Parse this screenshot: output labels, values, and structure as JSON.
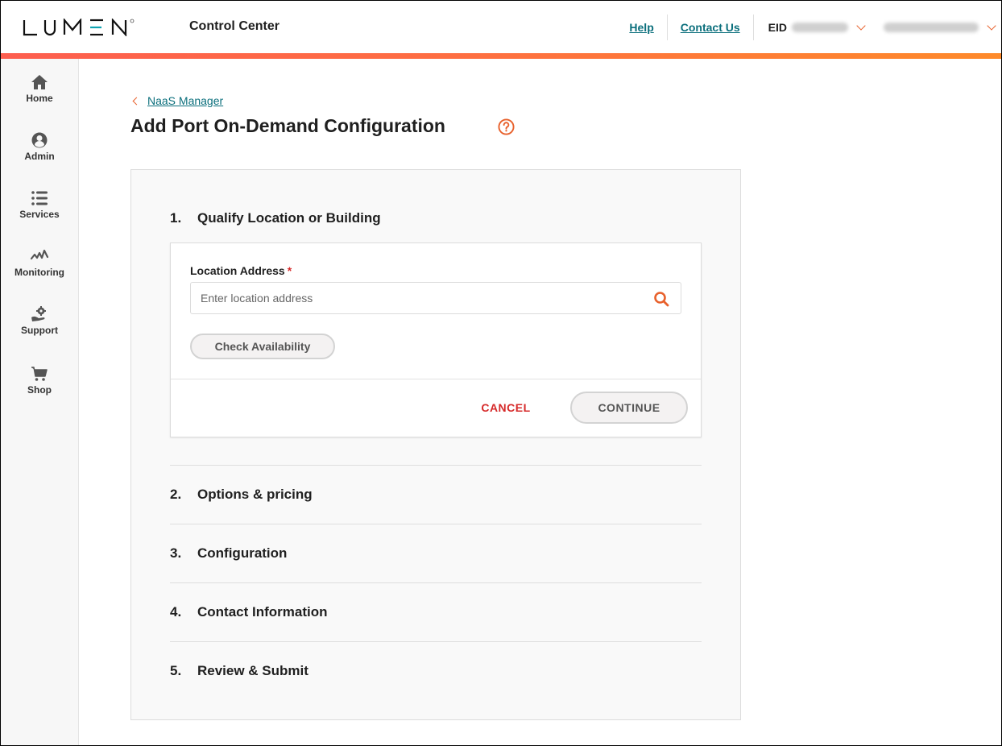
{
  "header": {
    "logo_text": "LUMEN",
    "app_title": "Control Center",
    "links": [
      "Help",
      "Contact Us"
    ],
    "eid_label": "EID",
    "eid_value_redacted": true,
    "user_value_redacted": true
  },
  "colors": {
    "brand_orange": "#e8612c",
    "link_teal": "#0b6f7c",
    "cancel_red": "#d62a2a",
    "gradient_start": "#fd5e4f",
    "gradient_end": "#fe8a2a"
  },
  "sidebar": {
    "items": [
      {
        "label": "Home",
        "icon": "home-icon"
      },
      {
        "label": "Admin",
        "icon": "user-circle-icon"
      },
      {
        "label": "Services",
        "icon": "list-icon"
      },
      {
        "label": "Monitoring",
        "icon": "pulse-icon"
      },
      {
        "label": "Support",
        "icon": "hand-gear-icon"
      },
      {
        "label": "Shop",
        "icon": "cart-icon"
      }
    ]
  },
  "breadcrumb": {
    "back_label": "NaaS Manager"
  },
  "page": {
    "title": "Add Port On-Demand Configuration",
    "help_icon": "question-circle-icon"
  },
  "steps": [
    {
      "number": "1.",
      "title": "Qualify Location or Building",
      "expanded": true
    },
    {
      "number": "2.",
      "title": "Options & pricing",
      "expanded": false
    },
    {
      "number": "3.",
      "title": "Configuration",
      "expanded": false
    },
    {
      "number": "4.",
      "title": "Contact Information",
      "expanded": false
    },
    {
      "number": "5.",
      "title": "Review & Submit",
      "expanded": false
    }
  ],
  "form": {
    "location_label": "Location Address",
    "required_marker": "*",
    "location_value": "",
    "location_placeholder": "Enter location address",
    "check_availability_label": "Check Availability",
    "cancel_label": "CANCEL",
    "continue_label": "CONTINUE"
  }
}
